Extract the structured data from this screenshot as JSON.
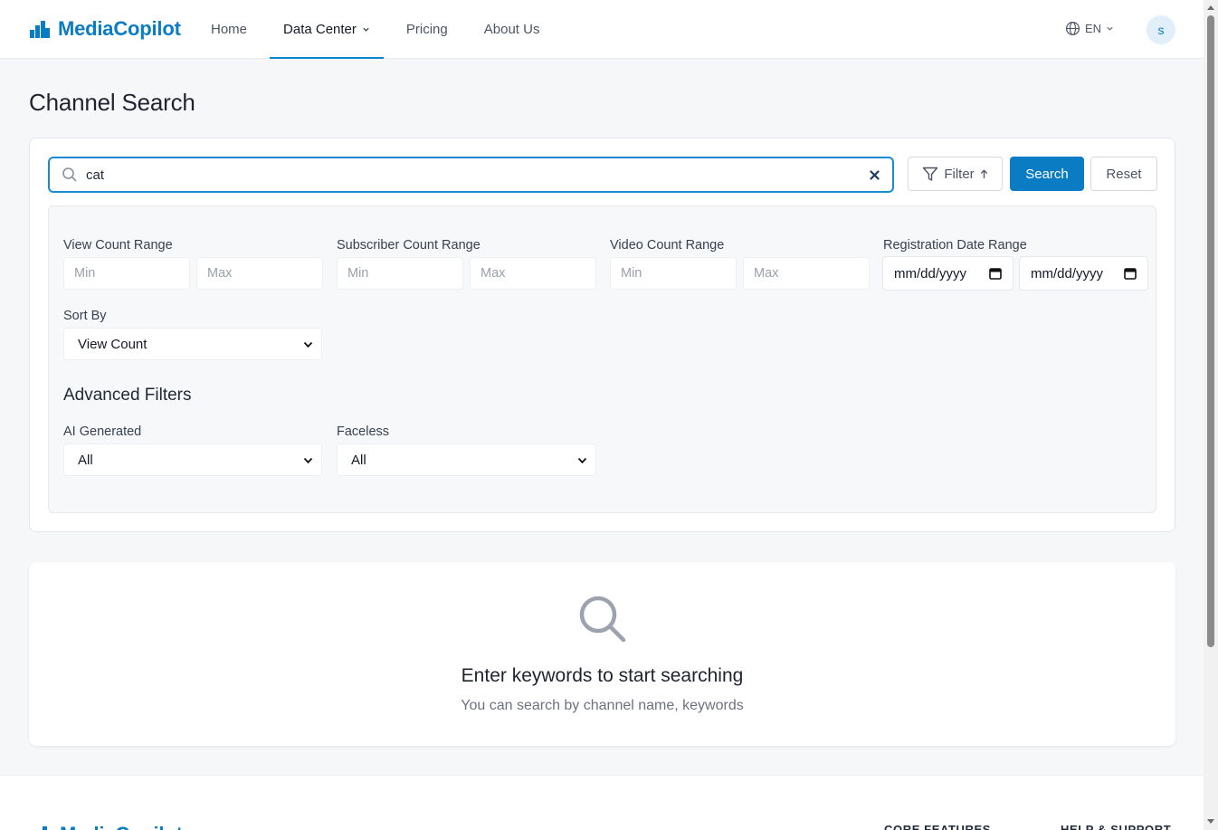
{
  "header": {
    "brand": "MediaCopilot",
    "nav": [
      {
        "label": "Home"
      },
      {
        "label": "Data Center",
        "active": true,
        "has_dropdown": true
      },
      {
        "label": "Pricing"
      },
      {
        "label": "About Us"
      }
    ],
    "language": "EN",
    "avatar_initial": "s"
  },
  "page": {
    "title": "Channel Search"
  },
  "search": {
    "value": "cat",
    "filter_label": "Filter",
    "search_label": "Search",
    "reset_label": "Reset"
  },
  "filters": {
    "view_count": {
      "label": "View Count Range",
      "min_placeholder": "Min",
      "max_placeholder": "Max"
    },
    "subscriber_count": {
      "label": "Subscriber Count Range",
      "min_placeholder": "Min",
      "max_placeholder": "Max"
    },
    "video_count": {
      "label": "Video Count Range",
      "min_placeholder": "Min",
      "max_placeholder": "Max"
    },
    "registration_date": {
      "label": "Registration Date Range",
      "start_placeholder": "mm/dd/yyyy",
      "end_placeholder": "mm/dd/yyyy"
    },
    "sort_by": {
      "label": "Sort By",
      "value": "View Count"
    },
    "advanced_title": "Advanced Filters",
    "ai_generated": {
      "label": "AI Generated",
      "value": "All"
    },
    "faceless": {
      "label": "Faceless",
      "value": "All"
    }
  },
  "empty_state": {
    "title": "Enter keywords to start searching",
    "subtitle": "You can search by channel name, keywords"
  },
  "footer": {
    "brand": "MediaCopilot",
    "col1": "CORE FEATURES",
    "col2": "HELP & SUPPORT"
  },
  "colors": {
    "brand": "#0a7cc4",
    "accent_border": "#1a8bd2",
    "background": "#f6f7f9"
  }
}
